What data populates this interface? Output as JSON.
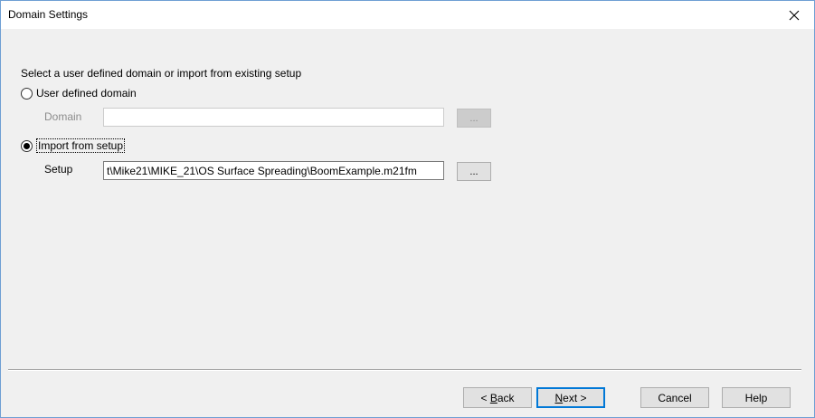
{
  "dialog": {
    "title": "Domain Settings",
    "close_symbol": "✕"
  },
  "content": {
    "instruction": "Select a user defined domain or import from existing setup",
    "options": [
      {
        "label": "User defined domain",
        "selected": false
      },
      {
        "label": "Import from setup",
        "selected": true
      }
    ],
    "domain": {
      "label": "Domain",
      "value": "",
      "enabled": false,
      "browse_label": "..."
    },
    "setup": {
      "label": "Setup",
      "value": "t\\Mike21\\MIKE_21\\OS Surface Spreading\\BoomExample.m21fm",
      "enabled": true,
      "browse_label": "..."
    }
  },
  "footer": {
    "back": {
      "prefix": "< ",
      "accel": "B",
      "rest": "ack"
    },
    "next": {
      "accel": "N",
      "rest": "ext >"
    },
    "cancel": "Cancel",
    "help": "Help"
  }
}
